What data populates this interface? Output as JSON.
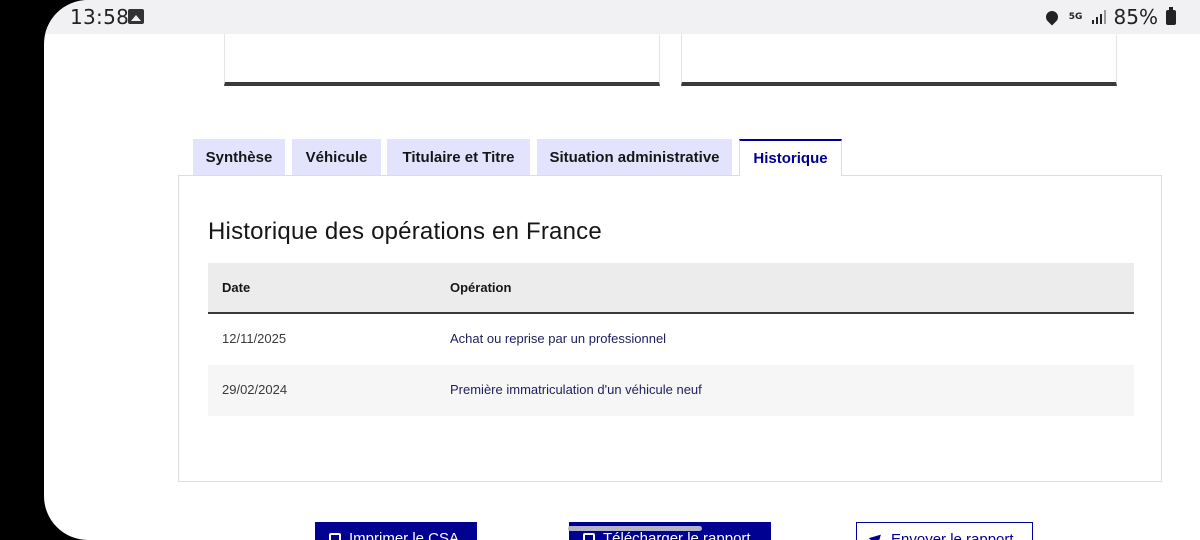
{
  "statusbar": {
    "time": "13:58",
    "network": "5G",
    "battery": "85%"
  },
  "tabs": [
    {
      "label": "Synthèse"
    },
    {
      "label": "Véhicule"
    },
    {
      "label": "Titulaire et Titre"
    },
    {
      "label": "Situation administrative"
    },
    {
      "label": "Historique",
      "active": true
    }
  ],
  "panel": {
    "title": "Historique des opérations en France",
    "table": {
      "headers": [
        "Date",
        "Opération"
      ],
      "rows": [
        [
          "12/11/2025",
          "Achat ou reprise par un professionnel"
        ],
        [
          "29/02/2024",
          "Première immatriculation d'un véhicule neuf"
        ]
      ]
    }
  },
  "actions": {
    "print": "Imprimer le CSA",
    "download": "Télécharger le rapport",
    "send": "Envoyer le rapport"
  },
  "colors": {
    "primary": "#000091",
    "tab_bg": "#e3e3fd",
    "header_bg": "#ececec"
  }
}
